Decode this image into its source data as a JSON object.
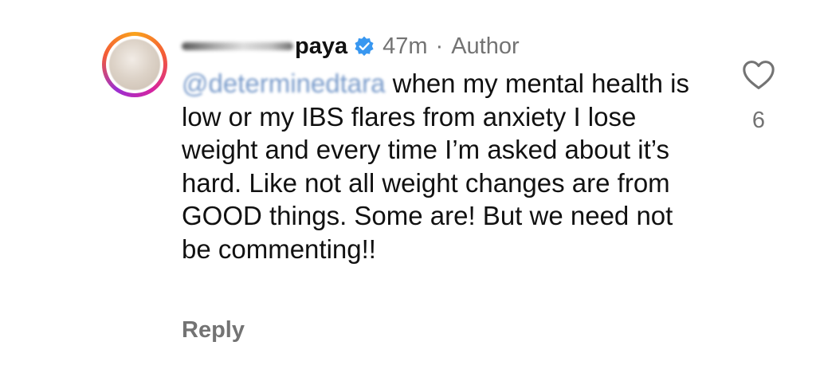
{
  "comment": {
    "username_visible": "paya",
    "time": "47m",
    "separator": "·",
    "author_badge": "Author",
    "mention": "@determinedtara",
    "body": " when my mental health is low or my IBS flares from anxiety I lose weight and every time I’m asked about it’s hard. Like not all weight changes are from GOOD things. Some are! But we need not be commenting!!",
    "reply_label": "Reply",
    "like_count": "6",
    "verified_color": "#3897f0",
    "icons": [
      "verified-badge-icon",
      "heart-icon"
    ]
  }
}
